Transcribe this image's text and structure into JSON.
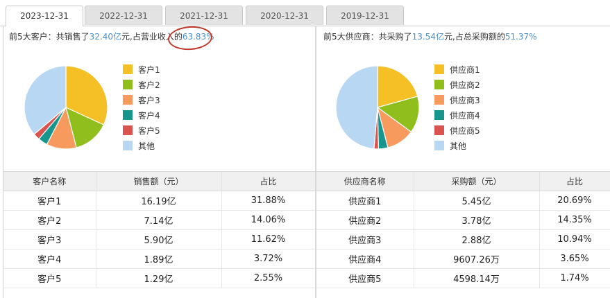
{
  "tabs": [
    "2023-12-31",
    "2022-12-31",
    "2021-12-31",
    "2020-12-31",
    "2019-12-31"
  ],
  "active_tab": "2023-12-31",
  "left": {
    "summary": {
      "prefix": "前5大客户：共销售了",
      "amount": "32.40亿",
      "mid": "元,占营业收入的",
      "pct": "63.83%"
    },
    "columns": [
      "客户名称",
      "销售额（元）",
      "占比"
    ],
    "rows": [
      [
        "客户1",
        "16.19亿",
        "31.88%"
      ],
      [
        "客户2",
        "7.14亿",
        "14.06%"
      ],
      [
        "客户3",
        "5.90亿",
        "11.62%"
      ],
      [
        "客户4",
        "1.89亿",
        "3.72%"
      ],
      [
        "客户5",
        "1.29亿",
        "2.55%"
      ]
    ]
  },
  "right": {
    "summary": {
      "prefix": "前5大供应商：共采购了",
      "amount": "13.54亿",
      "mid": "元,占总采购额的",
      "pct": "51.37%"
    },
    "columns": [
      "供应商名称",
      "采购额（元）",
      "占比"
    ],
    "rows": [
      [
        "供应商1",
        "5.45亿",
        "20.69%"
      ],
      [
        "供应商2",
        "3.78亿",
        "14.35%"
      ],
      [
        "供应商3",
        "2.88亿",
        "10.94%"
      ],
      [
        "供应商4",
        "9607.26万",
        "3.65%"
      ],
      [
        "供应商5",
        "4598.14万",
        "1.74%"
      ]
    ]
  },
  "colors": [
    "#f5c026",
    "#8fbe1d",
    "#f79a5d",
    "#17968e",
    "#d9534f",
    "#b7d7f3"
  ],
  "chart_data": [
    {
      "type": "pie",
      "labels": [
        "客户1",
        "客户2",
        "客户3",
        "客户4",
        "客户5",
        "其他"
      ],
      "values": [
        31.88,
        14.06,
        11.62,
        3.72,
        2.55,
        36.17
      ],
      "legend_position": "right"
    },
    {
      "type": "pie",
      "labels": [
        "供应商1",
        "供应商2",
        "供应商3",
        "供应商4",
        "供应商5",
        "其他"
      ],
      "values": [
        20.69,
        14.35,
        10.94,
        3.65,
        1.74,
        48.63
      ],
      "legend_position": "right"
    }
  ]
}
